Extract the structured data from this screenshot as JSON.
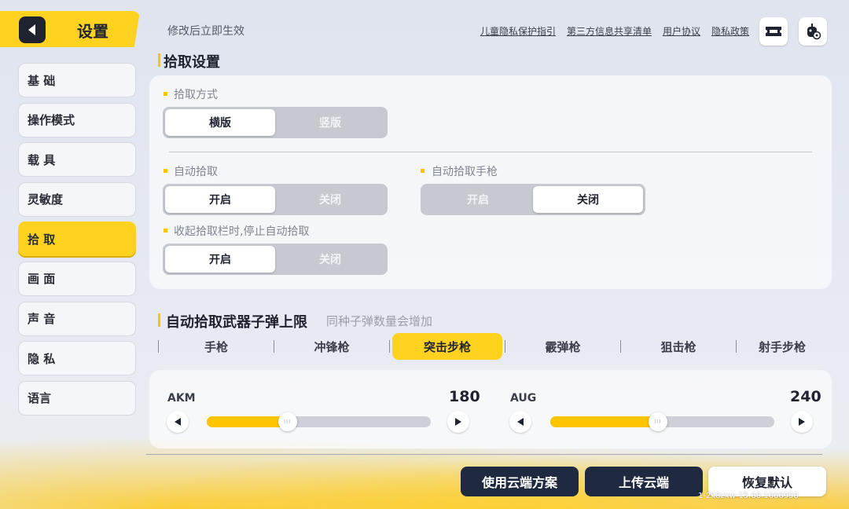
{
  "header": {
    "title": "设置",
    "hint": "修改后立即生效",
    "links": [
      "儿童隐私保护指引",
      "第三方信息共享清单",
      "用户协议",
      "隐私政策"
    ]
  },
  "sidebar": {
    "items": [
      {
        "label": "基 础"
      },
      {
        "label": "操作模式"
      },
      {
        "label": "载 具"
      },
      {
        "label": "灵敏度"
      },
      {
        "label": "拾 取",
        "active": true
      },
      {
        "label": "画 面"
      },
      {
        "label": "声 音"
      },
      {
        "label": "隐 私"
      },
      {
        "label": "语言"
      }
    ]
  },
  "pickup": {
    "title": "拾取设置",
    "mode": {
      "label": "拾取方式",
      "options": [
        "横版",
        "竖版"
      ],
      "selected": "横版"
    },
    "auto_pickup": {
      "label": "自动拾取",
      "options": [
        "开启",
        "关闭"
      ],
      "selected": "开启"
    },
    "auto_pickup_pistol": {
      "label": "自动拾取手枪",
      "options": [
        "开启",
        "关闭"
      ],
      "selected": "关闭"
    },
    "collapse_stop": {
      "label": "收起拾取栏时,停止自动拾取",
      "options": [
        "开启",
        "关闭"
      ],
      "selected": "开启"
    }
  },
  "ammo_limit": {
    "title": "自动拾取武器子弹上限",
    "subtitle": "同种子弹数量会增加",
    "tabs": [
      "手枪",
      "冲锋枪",
      "突击步枪",
      "霰弹枪",
      "狙击枪",
      "射手步枪"
    ],
    "active_tab": "突击步枪",
    "sliders": [
      {
        "name": "AKM",
        "value": "180",
        "fraction": 0.36
      },
      {
        "name": "AUG",
        "value": "240",
        "fraction": 0.48
      }
    ]
  },
  "footer": {
    "cloud_scheme": "使用云端方案",
    "upload_cloud": "上传云端",
    "restore_default": "恢复默认",
    "version": "1-2k8zxw-15.68.1666958"
  },
  "colors": {
    "accent": "#ffd21f",
    "dark": "#1f2a40"
  },
  "icons": [
    "back-arrow-icon",
    "ticket-icon",
    "robot-settings-icon",
    "arrow-left-icon",
    "arrow-right-icon"
  ]
}
